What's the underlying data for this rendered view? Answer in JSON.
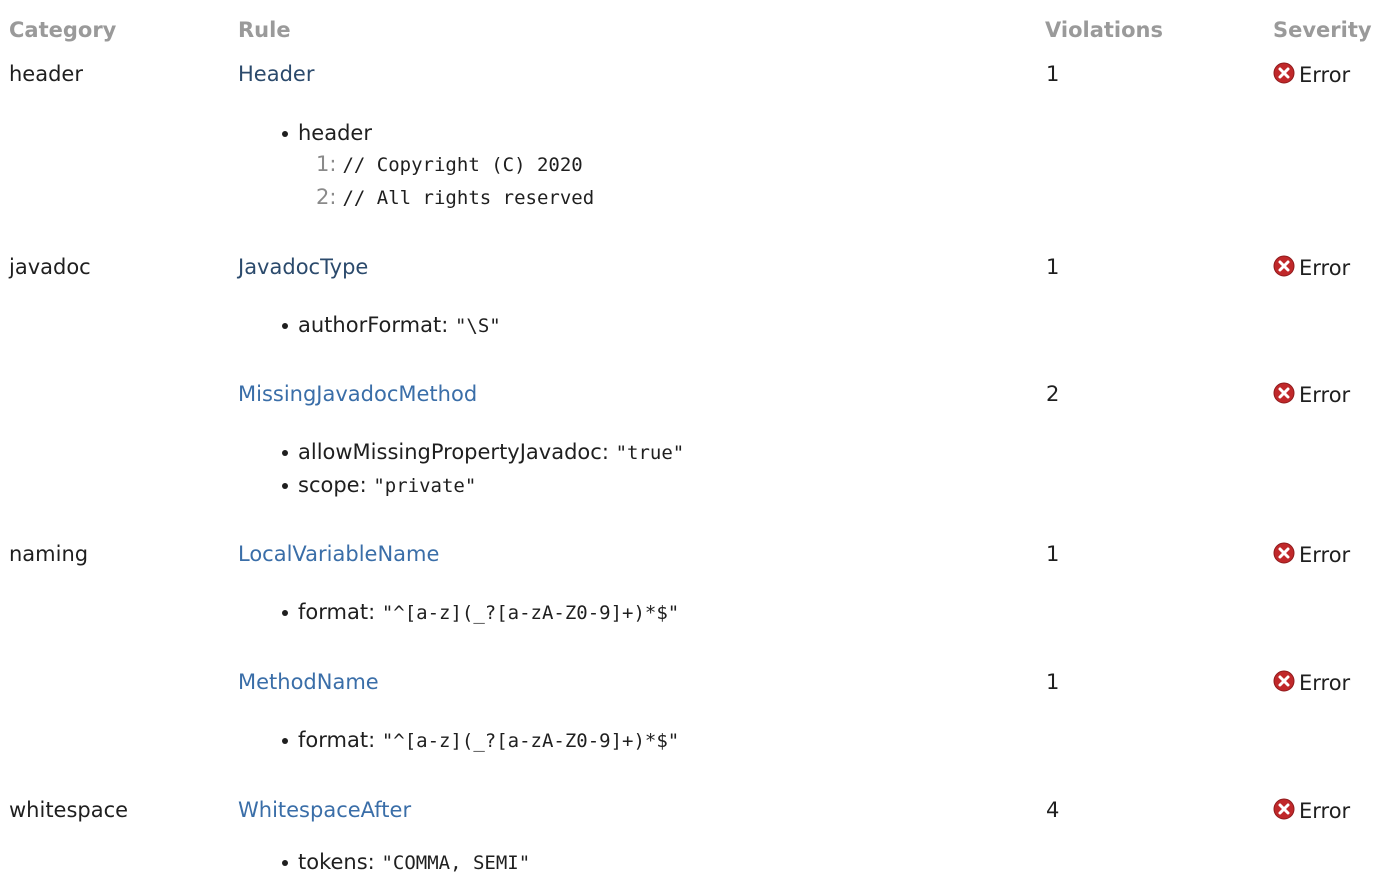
{
  "headers": {
    "category": "Category",
    "rule": "Rule",
    "violations": "Violations",
    "severity": "Severity"
  },
  "rows": [
    {
      "category": "header",
      "rule": "Header",
      "violations": "1",
      "severity": "Error",
      "properties": [
        {
          "name": "header",
          "value": ""
        }
      ],
      "code_lines": [
        {
          "num": "1:",
          "text": "// Copyright (C) 2020"
        },
        {
          "num": "2:",
          "text": "// All rights reserved"
        }
      ]
    },
    {
      "category": "javadoc",
      "rule": "JavadocType",
      "violations": "1",
      "severity": "Error",
      "properties": [
        {
          "name": "authorFormat:",
          "value": "\"\\S\""
        }
      ]
    },
    {
      "category": "",
      "rule": "MissingJavadocMethod",
      "violations": "2",
      "severity": "Error",
      "properties": [
        {
          "name": "allowMissingPropertyJavadoc:",
          "value": "\"true\""
        },
        {
          "name": "scope:",
          "value": "\"private\""
        }
      ]
    },
    {
      "category": "naming",
      "rule": "LocalVariableName",
      "violations": "1",
      "severity": "Error",
      "properties": [
        {
          "name": "format:",
          "value": "\"^[a-z](_?[a-zA-Z0-9]+)*$\""
        }
      ]
    },
    {
      "category": "",
      "rule": "MethodName",
      "violations": "1",
      "severity": "Error",
      "properties": [
        {
          "name": "format:",
          "value": "\"^[a-z](_?[a-zA-Z0-9]+)*$\""
        }
      ]
    },
    {
      "category": "whitespace",
      "rule": "WhitespaceAfter",
      "violations": "4",
      "severity": "Error",
      "properties": [
        {
          "name": "tokens:",
          "value": "\"COMMA, SEMI\""
        }
      ]
    }
  ],
  "colors": {
    "header_text": "#9a9a9a",
    "link": "#3a6ea8",
    "link_visited": "#2b4a6c",
    "error_icon": "#c0282a"
  },
  "icons": {
    "severity_error": "error-x-circle-icon"
  }
}
